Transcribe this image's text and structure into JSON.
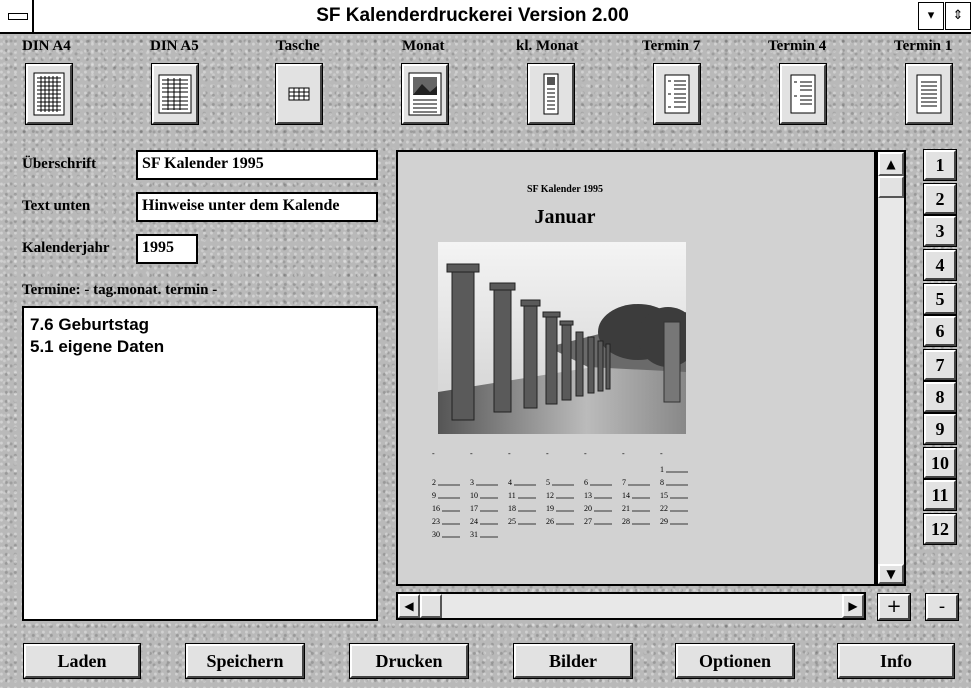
{
  "window": {
    "title": "SF Kalenderdruckerei Version 2.00"
  },
  "toolbar": [
    {
      "label": "DIN A4",
      "icon": "din-a4-layout-icon"
    },
    {
      "label": "DIN A5",
      "icon": "din-a5-layout-icon"
    },
    {
      "label": "Tasche",
      "icon": "pocket-calendar-icon"
    },
    {
      "label": "Monat",
      "icon": "month-calendar-icon"
    },
    {
      "label": "kl. Monat",
      "icon": "small-month-icon"
    },
    {
      "label": "Termin 7",
      "icon": "appointment-7-icon"
    },
    {
      "label": "Termin 4",
      "icon": "appointment-4-icon"
    },
    {
      "label": "Termin 1",
      "icon": "appointment-1-icon"
    }
  ],
  "form": {
    "heading_label": "Überschrift",
    "heading_value": "SF Kalender 1995",
    "footer_label": "Text unten",
    "footer_value": "Hinweise unter dem Kalende",
    "year_label": "Kalenderjahr",
    "year_value": "1995",
    "appointments_label": "Termine: -  tag.monat. termin  -"
  },
  "appointments": [
    "7.6 Geburtstag",
    "5.1 eigene Daten"
  ],
  "preview": {
    "small_title": "SF Kalender 1995",
    "month": "Januar",
    "weekday_marks": [
      "-",
      "-",
      "-",
      "-",
      "-",
      "-",
      "-"
    ],
    "calendar_rows": [
      [
        "",
        "",
        "",
        "",
        "",
        "",
        "1"
      ],
      [
        "2",
        "3",
        "4",
        "5",
        "6",
        "7",
        "8"
      ],
      [
        "9",
        "10",
        "11",
        "12",
        "13",
        "14",
        "15"
      ],
      [
        "16",
        "17",
        "18",
        "19",
        "20",
        "21",
        "22"
      ],
      [
        "23",
        "24",
        "25",
        "26",
        "27",
        "28",
        "29"
      ],
      [
        "30",
        "31",
        "",
        "",
        "",
        "",
        ""
      ]
    ]
  },
  "months": [
    "1",
    "2",
    "3",
    "4",
    "5",
    "6",
    "7",
    "8",
    "9",
    "10",
    "11",
    "12"
  ],
  "zoom": {
    "plus": "+",
    "minus": "-"
  },
  "buttons": [
    "Laden",
    "Speichern",
    "Drucken",
    "Bilder",
    "Optionen",
    "Info"
  ],
  "colors": {
    "background": "#b9b9b9",
    "panel": "#d2d2d2",
    "button": "#e2e2e2"
  }
}
